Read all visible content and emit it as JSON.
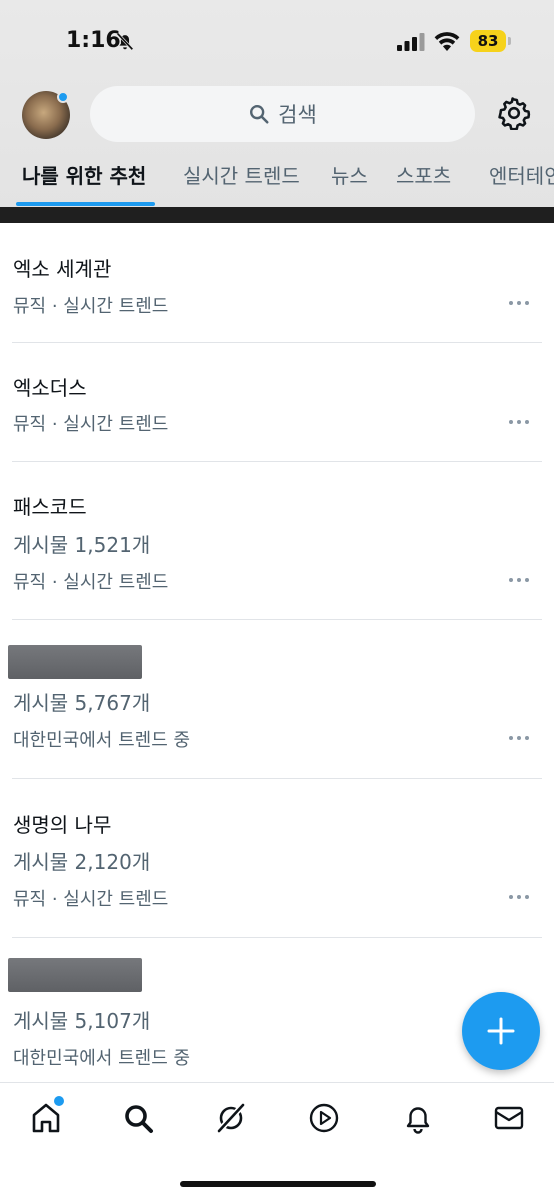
{
  "status_bar": {
    "time": "1:16",
    "battery": "83"
  },
  "header": {
    "search_placeholder": "검색"
  },
  "tabs": [
    {
      "label": "나를 위한 추천",
      "active": true
    },
    {
      "label": "실시간 트렌드",
      "active": false
    },
    {
      "label": "뉴스",
      "active": false
    },
    {
      "label": "스포츠",
      "active": false
    },
    {
      "label": "엔터테인",
      "active": false
    }
  ],
  "trends": [
    {
      "title": "엑소 세계관",
      "meta": "뮤직 · 실시간 트렌드"
    },
    {
      "title": "엑소더스",
      "meta": "뮤직 · 실시간 트렌드"
    },
    {
      "title": "패스코드",
      "count": "게시물 1,521개",
      "meta": "뮤직 · 실시간 트렌드"
    },
    {
      "title_redacted": true,
      "count": "게시물 5,767개",
      "meta": "대한민국에서 트렌드 중"
    },
    {
      "title": "생명의 나무",
      "count": "게시물 2,120개",
      "meta": "뮤직 · 실시간 트렌드"
    },
    {
      "title_redacted": true,
      "count": "게시물 5,107개",
      "meta": "대한민국에서 트렌드 중"
    }
  ],
  "colors": {
    "accent": "#1d9bf0",
    "battery": "#f6d21b",
    "secondary_text": "#536471"
  },
  "icons": {
    "status": [
      "bell-off-icon",
      "signal-icon",
      "wifi-icon",
      "battery-icon"
    ],
    "header": [
      "avatar",
      "search-icon",
      "gear-icon"
    ],
    "bottom_nav": [
      "home-icon",
      "search-icon",
      "grok-icon",
      "video-icon",
      "bell-icon",
      "mail-icon"
    ],
    "fab": "plus-icon"
  }
}
